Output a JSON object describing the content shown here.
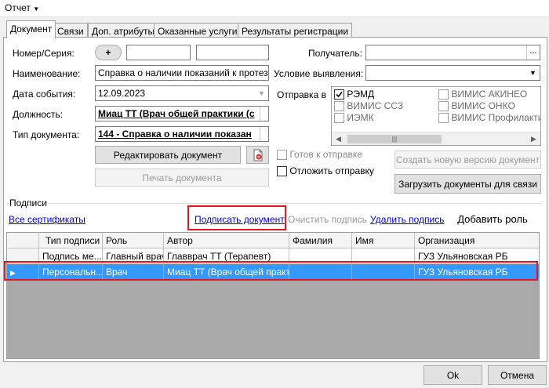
{
  "menu": {
    "title": "Отчет"
  },
  "tabs": [
    "Документ",
    "Связи",
    "Доп. атрибуты",
    "Оказанные услуги",
    "Результаты регистрации"
  ],
  "form": {
    "number_label": "Номер/Серия:",
    "plus_label": "+",
    "name_label": "Наименование:",
    "name_value": "Справка о наличии показаний к протезиро",
    "date_label": "Дата события:",
    "date_value": "12.09.2023",
    "position_label": "Должность:",
    "position_value": "Миац ТТ (Врач общей практики (с",
    "doctype_label": "Тип документа:",
    "doctype_value": "144 - Справка о наличии показан",
    "recipient_label": "Получатель:",
    "ellipsis": "...",
    "condition_label": "Условие выявления:",
    "send_label": "Отправка в",
    "send_targets": [
      {
        "label": "РЭМД",
        "checked": true,
        "enabled": true
      },
      {
        "label": "ВИМИС АКИНЕО",
        "checked": false,
        "enabled": false
      },
      {
        "label": "ВИМИС ССЗ",
        "checked": false,
        "enabled": false
      },
      {
        "label": "ВИМИС ОНКО",
        "checked": false,
        "enabled": false
      },
      {
        "label": "ИЭМК",
        "checked": false,
        "enabled": false
      },
      {
        "label": "ВИМИС Профилактик",
        "checked": false,
        "enabled": false
      }
    ],
    "edit_button": "Редактировать документ",
    "print_button": "Печать документа",
    "ready_label": "Готов к отправке",
    "postpone_label": "Отложить отправку",
    "new_version_button": "Создать новую версию документ",
    "upload_button": "Загрузить документы для связи"
  },
  "signatures": {
    "group_label": "Подписи",
    "all_certs": "Все сертификаты",
    "sign": "Подписать документ",
    "clear": "Очистить подпись",
    "delete": "Удалить подпись",
    "add_role": "Добавить роль",
    "columns": [
      "Тип подписи",
      "Роль",
      "Автор",
      "Фамилия",
      "Имя",
      "Организация"
    ],
    "rows": [
      [
        "Подпись ме...",
        "Главный врач",
        "Главврач ТТ (Терапевт)",
        "",
        "",
        "ГУЗ Ульяновская РБ"
      ],
      [
        "Персональн...",
        "Врач",
        "Миац ТТ (Врач общей практ...",
        "",
        "",
        "ГУЗ Ульяновская РБ"
      ]
    ]
  },
  "footer": {
    "ok": "Ok",
    "cancel": "Отмена"
  },
  "colors": {
    "selection": "#3399ff",
    "highlight": "#e8141b",
    "link": "#0000ee"
  },
  "icons": [
    "dropdown-arrow-icon",
    "scroll-left-icon",
    "scroll-right-icon",
    "row-pointer-icon",
    "document-icon"
  ]
}
